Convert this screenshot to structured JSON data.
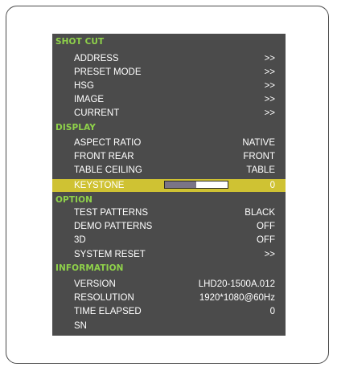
{
  "sections": [
    {
      "id": "shot-cut",
      "title": "SHOT CUT",
      "items": [
        {
          "label": "ADDRESS",
          "value": ">>"
        },
        {
          "label": "PRESET MODE",
          "value": ">>"
        },
        {
          "label": "HSG",
          "value": ">>"
        },
        {
          "label": "IMAGE",
          "value": ">>"
        },
        {
          "label": "CURRENT",
          "value": ">>"
        }
      ]
    },
    {
      "id": "display",
      "title": "DISPLAY",
      "items": [
        {
          "label": "ASPECT RATIO",
          "value": "NATIVE"
        },
        {
          "label": "FRONT REAR",
          "value": "FRONT"
        },
        {
          "label": "TABLE CEILING",
          "value": "TABLE"
        },
        {
          "label": "KEYSTONE",
          "value": "0"
        }
      ]
    },
    {
      "id": "option",
      "title": "OPTION",
      "items": [
        {
          "label": "TEST PATTERNS",
          "value": "BLACK"
        },
        {
          "label": "DEMO PATTERNS",
          "value": "OFF"
        },
        {
          "label": "3D",
          "value": "OFF"
        },
        {
          "label": "SYSTEM RESET",
          "value": ">>"
        }
      ]
    },
    {
      "id": "information",
      "title": "INFORMATION",
      "items": [
        {
          "label": "VERSION",
          "value": "LHD20-1500A.012"
        },
        {
          "label": "RESOLUTION",
          "value": "1920*1080@60Hz"
        },
        {
          "label": "TIME ELAPSED",
          "value": "0"
        },
        {
          "label": "SN",
          "value": ""
        }
      ]
    }
  ],
  "keystone_slider_level": 0.5,
  "colors": {
    "panel_bg": "#4b4b4b",
    "section_title": "#8fd24a",
    "selected_row": "#cfc233",
    "text": "#ffffff"
  }
}
